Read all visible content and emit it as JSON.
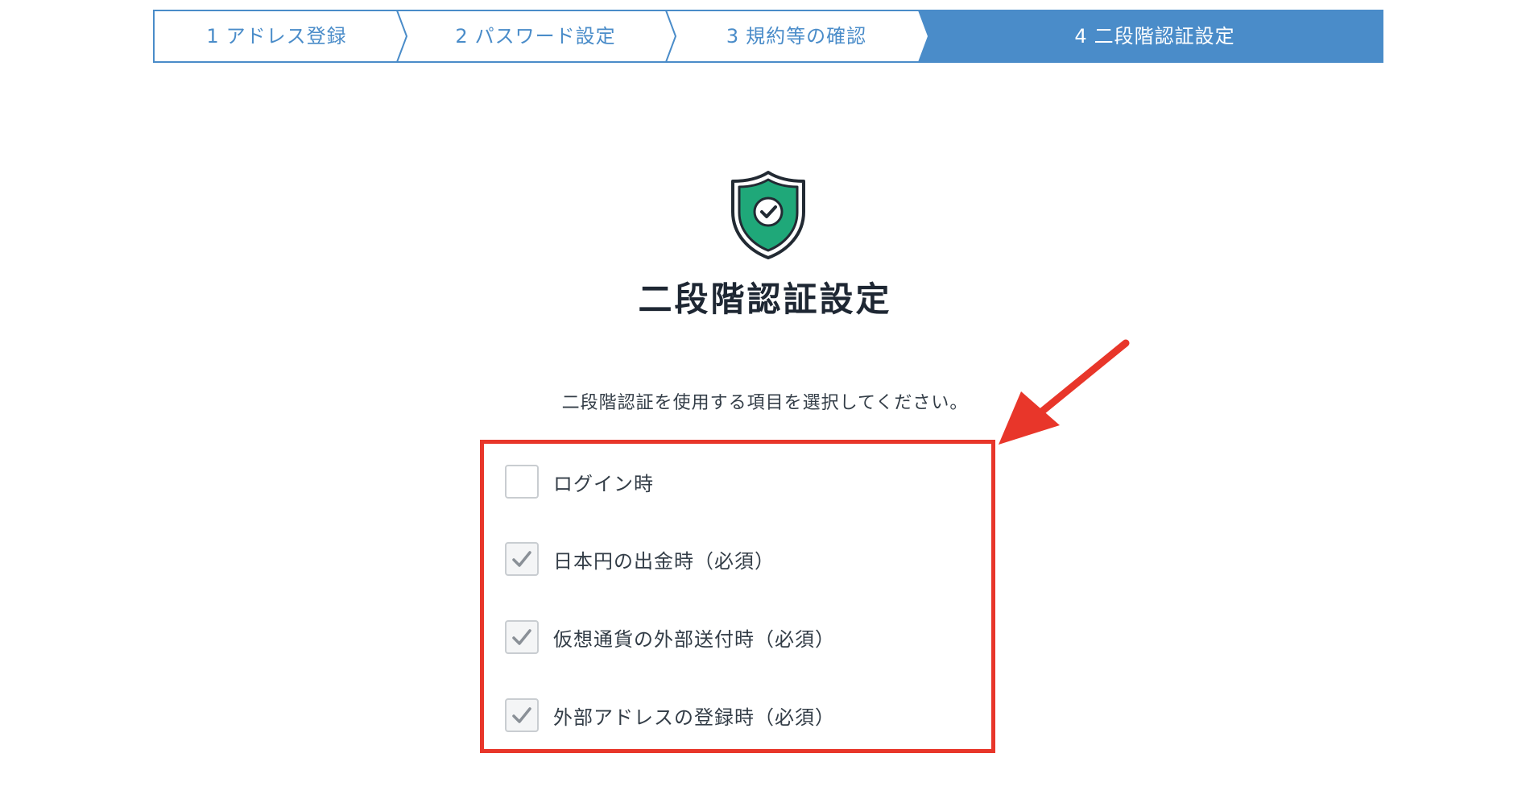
{
  "steps": [
    {
      "number": "1",
      "label": "アドレス登録"
    },
    {
      "number": "2",
      "label": "パスワード設定"
    },
    {
      "number": "3",
      "label": "規約等の確認"
    },
    {
      "number": "4",
      "label": "二段階認証設定"
    }
  ],
  "active_step": 4,
  "title": "二段階認証設定",
  "instruction": "二段階認証を使用する項目を選択してください。",
  "options": [
    {
      "label": "ログイン時",
      "checked": false
    },
    {
      "label": "日本円の出金時（必須）",
      "checked": true
    },
    {
      "label": "仮想通貨の外部送付時（必須）",
      "checked": true
    },
    {
      "label": "外部アドレスの登録時（必須）",
      "checked": true
    }
  ],
  "icons": {
    "header": "shield-check-icon",
    "checkbox_mark": "checkmark-icon",
    "annotation": "red-arrow-icon"
  },
  "colors": {
    "accent_blue": "#4a8cc9",
    "shield_green": "#1fa879",
    "highlight_red": "#e8362a"
  }
}
